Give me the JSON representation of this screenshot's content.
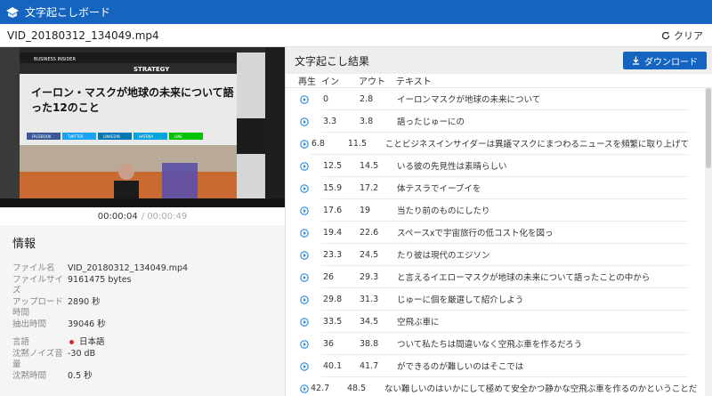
{
  "app": {
    "title": "文字起こしボード"
  },
  "file": {
    "name": "VID_20180312_134049.mp4",
    "clear_label": "クリア"
  },
  "player": {
    "current_time": "00:00:04",
    "duration": "/ 00:00:49",
    "scene": {
      "brand": "BUSINESS INSIDER",
      "section": "STRATEGY",
      "headline_line1": "イーロン・マスクが地球の未来について語",
      "headline_line2": "った12のこと",
      "share": [
        "FACEBOOK",
        "TWITTER",
        "LINKEDIN",
        "HATENA",
        "LINE"
      ]
    }
  },
  "info": {
    "heading": "情報",
    "rows": [
      {
        "key": "ファイル名",
        "value": "VID_20180312_134049.mp4"
      },
      {
        "key": "ファイルサイズ",
        "value": "9161475 bytes"
      },
      {
        "key": "アップロード時間",
        "value": "2890 秒"
      },
      {
        "key": "抽出時間",
        "value": "39046 秒"
      }
    ],
    "rows2": [
      {
        "key": "言語",
        "value": "日本語"
      },
      {
        "key": "沈黙ノイズ音量",
        "value": "-30 dB"
      },
      {
        "key": "沈黙時間",
        "value": "0.5 秒"
      }
    ]
  },
  "results": {
    "title": "文字起こし結果",
    "download_label": "ダウンロード",
    "headers": {
      "play": "再生",
      "in": "イン",
      "out": "アウト",
      "text": "テキスト"
    },
    "rows": [
      {
        "in": "0",
        "out": "2.8",
        "text": "イーロンマスクが地球の未来について"
      },
      {
        "in": "3.3",
        "out": "3.8",
        "text": "語ったじゅーにの"
      },
      {
        "in": "6.8",
        "out": "11.5",
        "text": "ことビジネスインサイダーは異議マスクにまつわるニュースを頻繁に取り上げて"
      },
      {
        "in": "12.5",
        "out": "14.5",
        "text": "いる彼の先見性は素晴らしい"
      },
      {
        "in": "15.9",
        "out": "17.2",
        "text": "体テスラでイーブイを"
      },
      {
        "in": "17.6",
        "out": "19",
        "text": "当たり前のものにしたり"
      },
      {
        "in": "19.4",
        "out": "22.6",
        "text": "スペースxで宇宙旅行の低コスト化を図っ"
      },
      {
        "in": "23.3",
        "out": "24.5",
        "text": "たり彼は現代のエジソン"
      },
      {
        "in": "26",
        "out": "29.3",
        "text": "と言えるイエローマスクが地球の未来について語ったことの中から"
      },
      {
        "in": "29.8",
        "out": "31.3",
        "text": "じゅーに個を厳選して紹介しよう"
      },
      {
        "in": "33.5",
        "out": "34.5",
        "text": "空飛ぶ車に"
      },
      {
        "in": "36",
        "out": "38.8",
        "text": "ついて私たちは間違いなく空飛ぶ車を作るだろう"
      },
      {
        "in": "40.1",
        "out": "41.7",
        "text": "ができるのが難しいのはそこでは"
      },
      {
        "in": "42.7",
        "out": "48.5",
        "text": "ない難しいのはいかにして極めて安全かつ静かな空飛ぶ車を作るのかということだ"
      }
    ]
  },
  "colors": {
    "primary": "#1565c0",
    "play_icon": "#1e88e5",
    "language_dot": "#d32f2f"
  }
}
